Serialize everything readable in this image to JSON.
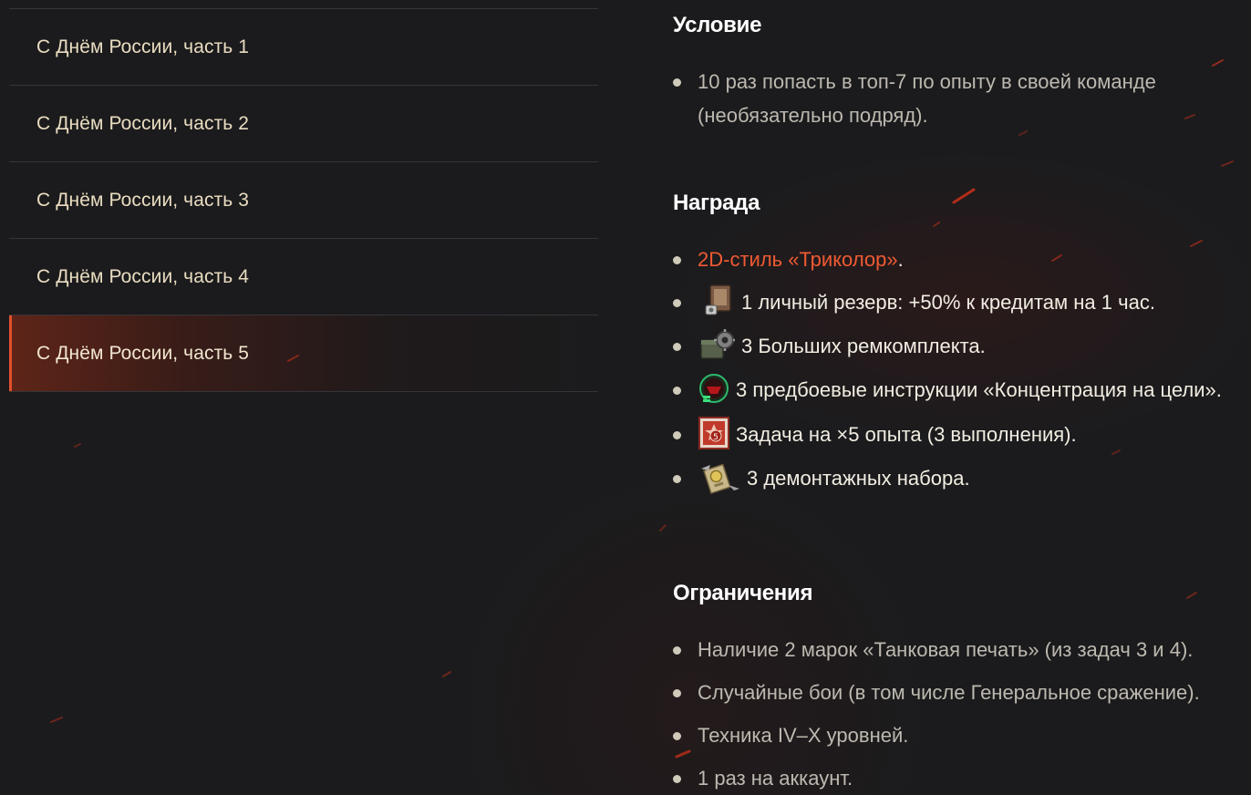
{
  "sidebar": {
    "items": [
      {
        "label": "С Днём России, часть 1"
      },
      {
        "label": "С Днём России, часть 2"
      },
      {
        "label": "С Днём России, часть 3"
      },
      {
        "label": "С Днём России, часть 4"
      },
      {
        "label": "С Днём России, часть 5",
        "active": true
      }
    ]
  },
  "condition": {
    "title": "Условие",
    "items": [
      "10 раз попасть в топ-7 по опыту в своей команде (необязательно подряд)."
    ]
  },
  "reward": {
    "title": "Награда",
    "style_link": "2D-стиль «Триколор»",
    "style_suffix": ".",
    "items": [
      {
        "icon": "personal-reserve-icon",
        "text": "1 личный резерв: +50% к кредитам на 1 час."
      },
      {
        "icon": "repair-kit-icon",
        "text": "3 Больших ремкомплекта."
      },
      {
        "icon": "combat-instruction-icon",
        "text": "3 предбоевые инструкции «Концентрация на цели»."
      },
      {
        "icon": "xp-multiplier-icon",
        "text": "Задача на ×5 опыта (3 выполнения)."
      },
      {
        "icon": "demounting-kit-icon",
        "text": "3 демонтажных набора."
      }
    ]
  },
  "restrictions": {
    "title": "Ограничения",
    "items": [
      "Наличие 2 марок «Танковая печать» (из задач 3 и 4).",
      "Случайные бои (в том числе Генеральное сражение).",
      "Техника IV–X уровней.",
      "1 раз на аккаунт."
    ]
  },
  "colors": {
    "background": "#1b1b1d",
    "accent": "#ef5a33",
    "nav_text": "#e9dcc0",
    "body_text": "#bdb9b0",
    "heading": "#ffffff"
  }
}
